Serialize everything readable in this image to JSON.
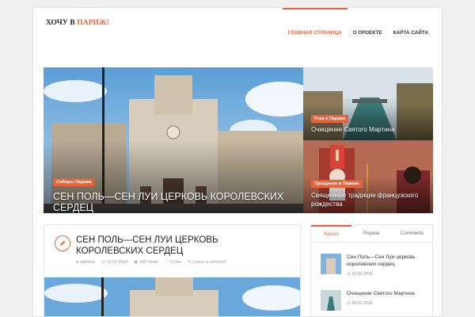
{
  "header": {
    "logo_main": "ХОЧУ В ",
    "logo_accent": "ПАРИЖ!",
    "nav": [
      {
        "label": "ГЛАВНАЯ СТРАНИЦА",
        "active": true
      },
      {
        "label": "О ПРОЕКТЕ",
        "active": false
      },
      {
        "label": "КАРТА САЙТА",
        "active": false
      }
    ]
  },
  "featured": {
    "main": {
      "category": "Соборы Парижа",
      "title": "СЕН ПОЛЬ—СЕН ЛУИ ЦЕРКОВЬ КОРОЛЕВСКИХ СЕРДЕЦ"
    },
    "top_right": {
      "category": "Река в Париже",
      "title": "Очищение Святого Мартина"
    },
    "bottom_right": {
      "category": "Праздники в Париже",
      "title": "Священные традиции французского рождества"
    }
  },
  "post": {
    "title": "СЕН ПОЛЬ—СЕН ЛУИ ЦЕРКОВЬ КОРОЛЕВСКИХ СЕРДЕЦ",
    "author": "admirus",
    "date": "19.02.2016",
    "views": "145 Views",
    "likes": "0 Like",
    "comment": "Leave a comment"
  },
  "sidebar": {
    "tabs": [
      "Recent",
      "Popular",
      "Comments"
    ],
    "items": [
      {
        "title": "Сен Поль—Сен Луи церковь королевских сердец",
        "date": "19.02.2016"
      },
      {
        "title": "Очищение Святого Мартина",
        "date": "29.01.2016"
      }
    ]
  },
  "colors": {
    "accent": "#e8623c",
    "text": "#222222"
  }
}
